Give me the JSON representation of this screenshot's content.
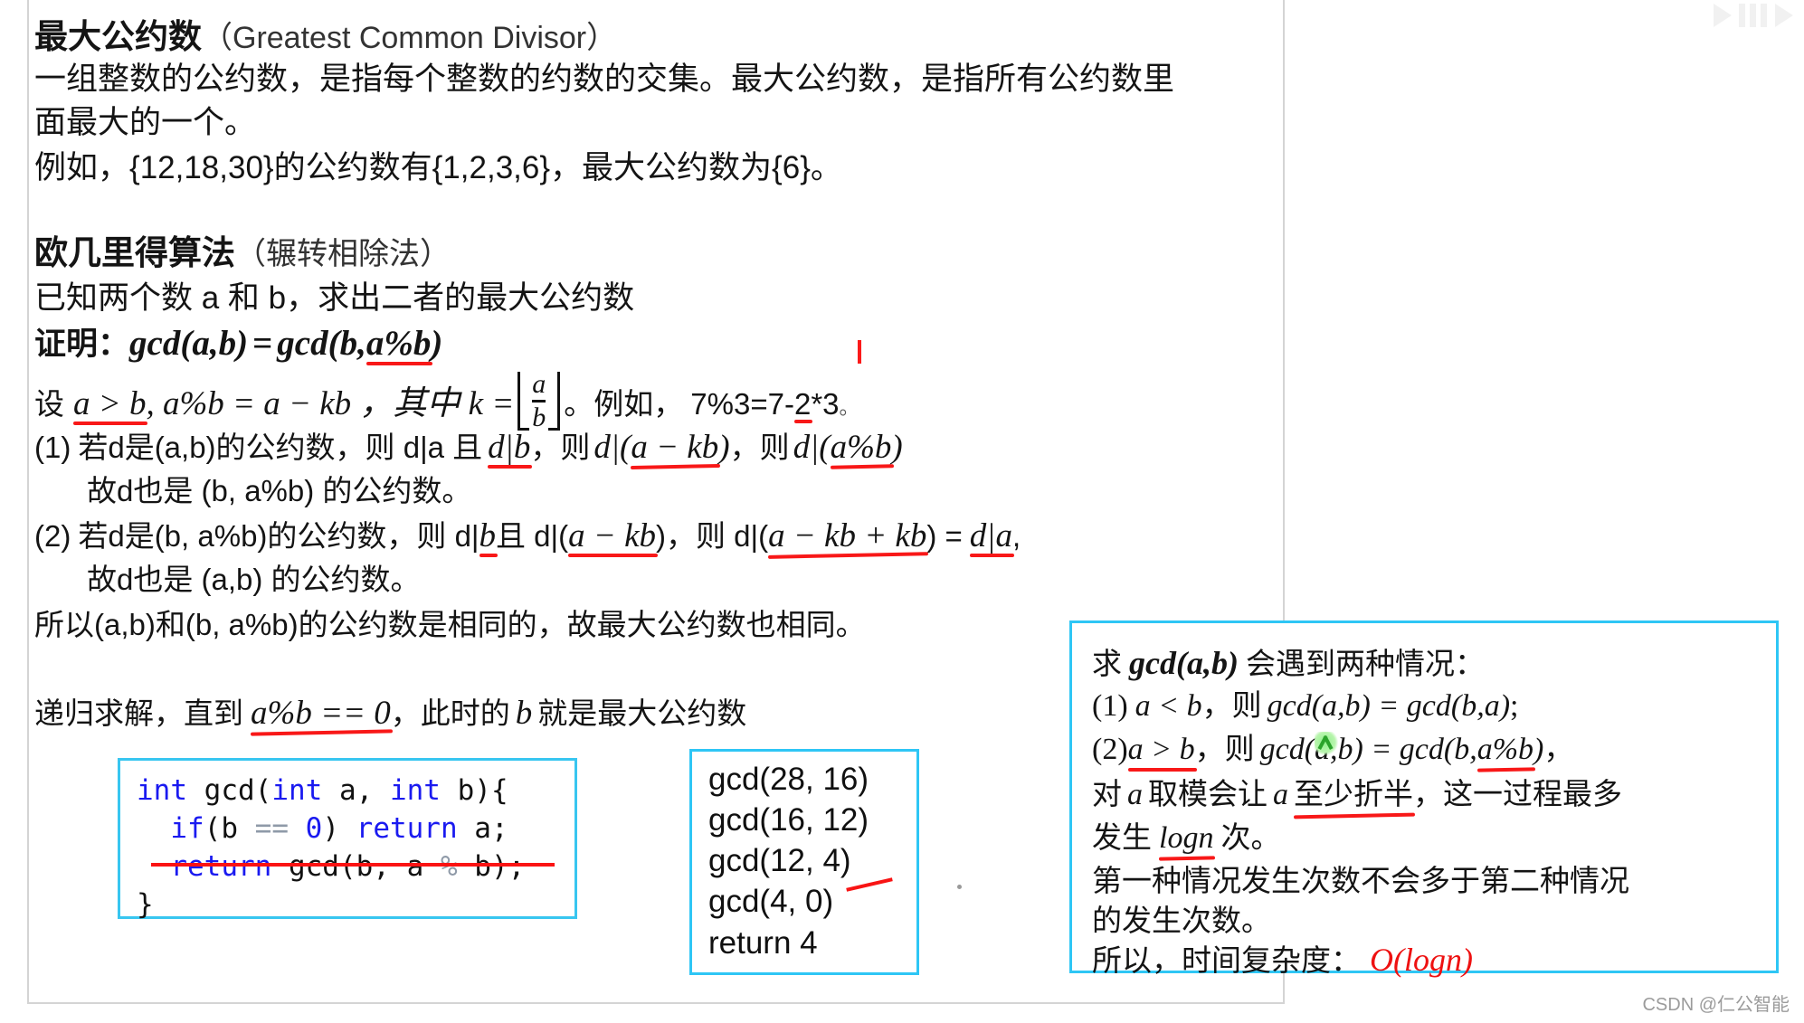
{
  "colors": {
    "annotation_red": "#f81818",
    "box_border_blue": "#2ec6f5",
    "code_keyword_blue": "#1a1af0",
    "complexity_red": "#ee1111",
    "cursor_green": "#2aa32a",
    "watermark_gray": "#9b9b9b"
  },
  "section1": {
    "heading_cn": "最大公约数",
    "heading_en": "（Greatest Common Divisor）",
    "para_line1": "一组整数的公约数，是指每个整数的约数的交集。最大公约数，是指所有公约数里",
    "para_line2": "面最大的一个。",
    "para_line3": "例如，{12,18,30}的公约数有{1,2,3,6}，最大公约数为{6}。"
  },
  "section2": {
    "heading_cn": "欧几里得算法",
    "heading_en": "（辗转相除法）",
    "given_line": "已知两个数 a 和 b，求出二者的最大公约数",
    "proof_label": "证明：",
    "proof_formula": {
      "lhs": "gcd(a,b)",
      "eq": "=",
      "rhs_prefix": "gcd(b,",
      "rhs_underlined": "a%b",
      "rhs_suffix": ")"
    },
    "setup_line": {
      "prefix": "设",
      "underlined": "a > b",
      "mid": ", a%b = a − kb ，其中 k =",
      "fraction_num": "a",
      "fraction_den": "b",
      "after": "。例如，",
      "example": "7%3=7-2*3",
      "example_underlined_char": "2",
      "period": "。"
    },
    "step1": {
      "label": "(1)",
      "text_a": "若d是(a,b)的公约数，则 d|a 且",
      "ul_1": "d|b",
      "text_b": "，则",
      "ul_2": "d|(a − kb)",
      "text_c": "，则",
      "ul_3": "d|(a%b)",
      "sub_line": "故d也是 (b, a%b) 的公约数。"
    },
    "step2": {
      "label": "(2)",
      "text_a": "若d是(b, a%b)的公约数，则 d|",
      "ul_1": "b",
      "text_b": "且 d|(",
      "ul_2": "a − kb",
      "text_c": ")，则 d|(",
      "ul_3": "a − kb + kb",
      "text_d": ") =",
      "ul_4": "d|a",
      "text_e": ",",
      "sub_line": "故d也是 (a,b) 的公约数。"
    },
    "conclusion": "所以(a,b)和(b, a%b)的公约数是相同的，故最大公约数也相同。",
    "recursion_line": {
      "prefix": "递归求解，直到",
      "underlined": "a%b == 0",
      "mid": "，此时的",
      "var": "b",
      "suffix": "就是最大公约数"
    }
  },
  "code_box": {
    "lines": [
      "int gcd(int a, int b){",
      "  if(b == 0) return a;",
      "  return gcd(b, a % b);",
      "}"
    ],
    "tokens": {
      "kw_int": "int",
      "kw_if": "if",
      "kw_return": "return",
      "fn_name": "gcd",
      "param_a": "a",
      "param_b": "b",
      "zero": "0",
      "mod": "%"
    }
  },
  "trace_box": {
    "lines": [
      "gcd(28, 16)",
      "gcd(16, 12)",
      "gcd(12, 4)",
      "gcd(4, 0)",
      "return 4"
    ]
  },
  "note_box": {
    "line1_prefix": "求",
    "line1_formula": "gcd(a,b)",
    "line1_suffix": "会遇到两种情况：",
    "case1": {
      "label": "(1)",
      "cond": "a < b",
      "mid": "，则",
      "formula": "gcd(a,b)  =  gcd(b,a)",
      "end": ";"
    },
    "case2": {
      "label": "(2)",
      "cond": "a > b",
      "mid": "，则",
      "formula_prefix": "gcd(a,b)  =  gcd(b,",
      "formula_underlined": "a%b",
      "formula_suffix": ")",
      "end": "，"
    },
    "line4_a": "对",
    "line4_var": "a",
    "line4_b": "取模会让",
    "line4_var2": "a",
    "line4_ul": "至少折半",
    "line4_c": "，这一过程最多",
    "line5_a": "发生",
    "line5_ul": "logn",
    "line5_b": "次。",
    "line6": "第一种情况发生次数不会多于第二种情况",
    "line7": "的发生次数。",
    "line8_prefix": "所以，时间复杂度：",
    "line8_complexity": "O(logn)"
  },
  "watermark": {
    "csdn": "CSDN @仁公智能"
  }
}
